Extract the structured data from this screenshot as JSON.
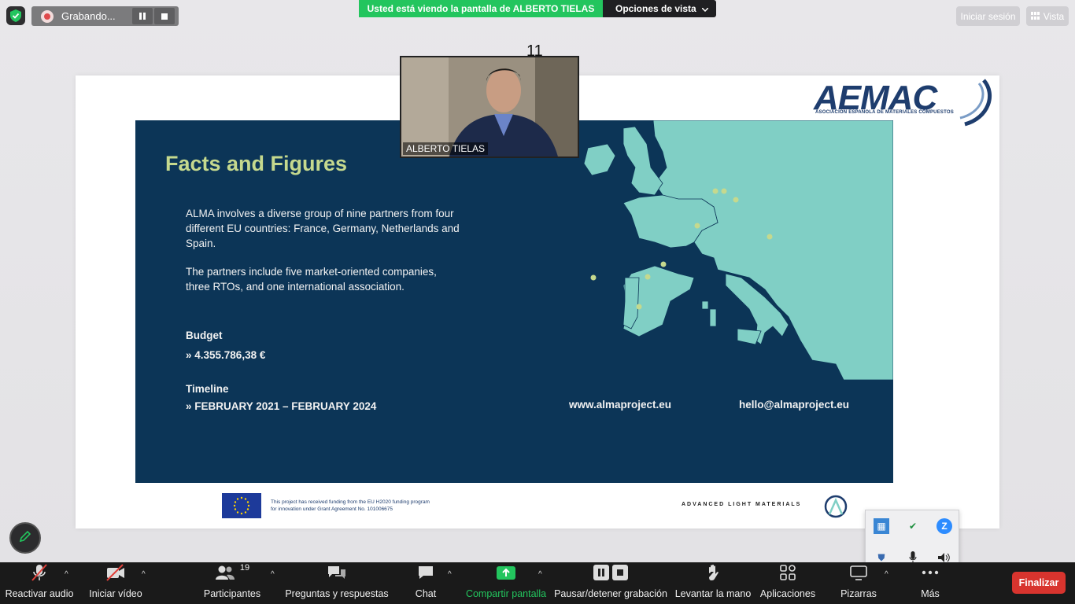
{
  "recording": {
    "label": "Grabando..."
  },
  "banner": {
    "viewing": "Usted está viendo la pantalla de ALBERTO TIELAS",
    "view_options": "Opciones de vista"
  },
  "top_right": {
    "sign_in": "Iniciar sesión",
    "view": "Vista"
  },
  "slide": {
    "page_number": "11",
    "logo_word": "AEMAC",
    "logo_sub": "ASOCIACIÓN ESPAÑOLA DE MATERIALES COMPUESTOS",
    "title": "Facts and Figures",
    "para1": "ALMA involves a diverse group of nine partners from four different EU countries: France, Germany, Netherlands and Spain.",
    "para2": "The partners include five market-oriented companies, three RTOs, and one international association.",
    "budget_label": "Budget",
    "budget_value": "»  4.355.786,38 €",
    "timeline_label": "Timeline",
    "timeline_value": "»  FEBRUARY 2021 – FEBRUARY 2024",
    "website": "www.almaproject.eu",
    "email": "hello@almaproject.eu",
    "funding": "This project has received funding from the EU H2020 funding program for innovation under Grant Agreement No. 101006675",
    "alma_text": "ADVANCED LIGHT MATERIALS"
  },
  "video": {
    "name": "ALBERTO TIELAS"
  },
  "toolbar": {
    "audio": "Reactivar audio",
    "video": "Iniciar vídeo",
    "participants": "Participantes",
    "participants_count": "19",
    "qa": "Preguntas y respuestas",
    "chat": "Chat",
    "share": "Compartir pantalla",
    "recording": "Pausar/detener grabación",
    "hand": "Levantar la mano",
    "apps": "Aplicaciones",
    "whiteboards": "Pizarras",
    "more": "Más",
    "end": "Finalizar"
  },
  "colors": {
    "accent_green": "#23c55e",
    "slide_navy": "#0c3557",
    "title_green": "#c5d98e",
    "map_teal": "#80cfc5",
    "end_red": "#d8342e"
  }
}
